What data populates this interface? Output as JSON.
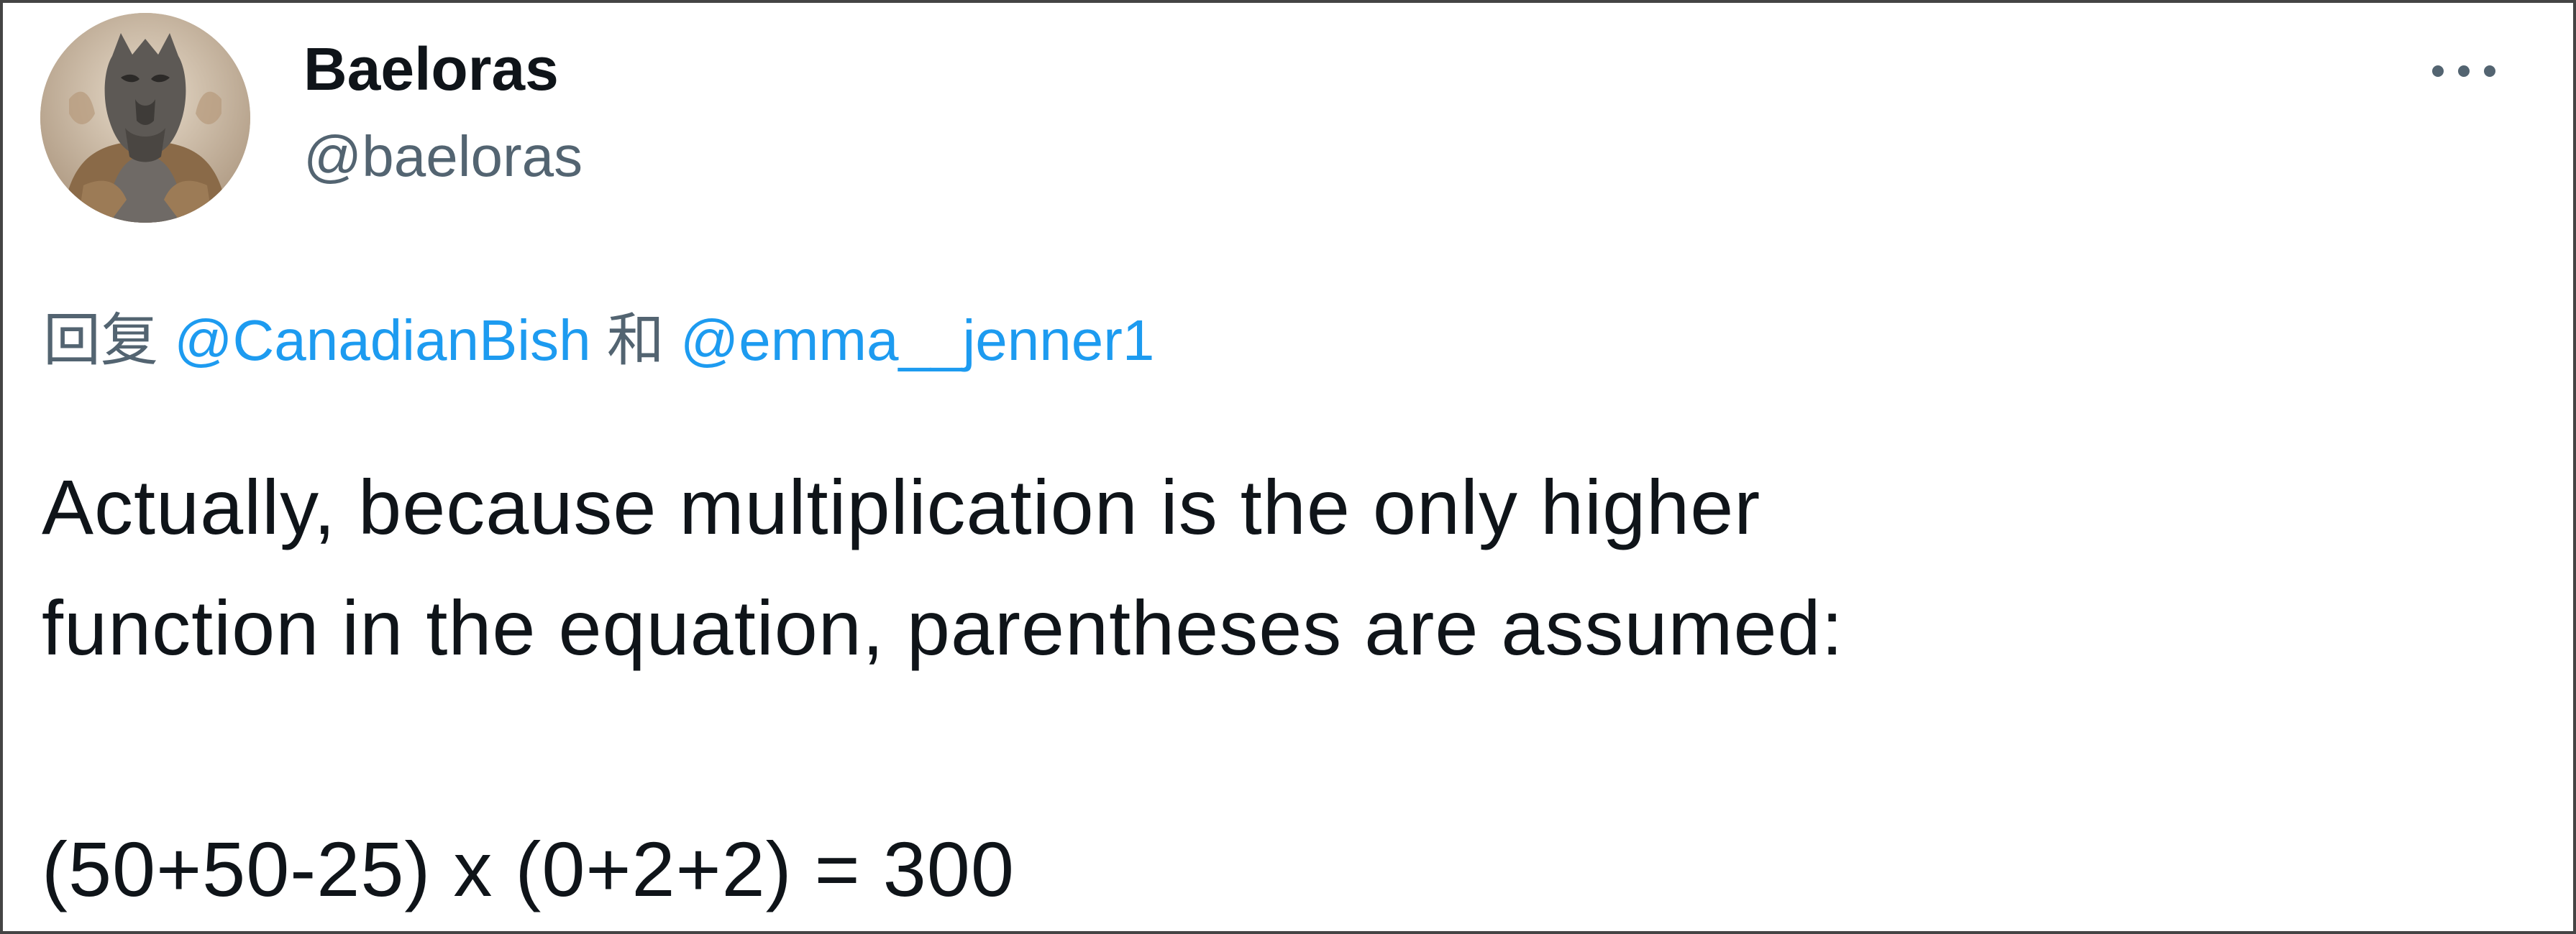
{
  "tweet": {
    "display_name": "Baeloras",
    "handle": "@baeloras",
    "avatar_icon": "avatar-image",
    "more_icon": "more-options-icon",
    "reply": {
      "prefix": "回复",
      "mentions": [
        "@CanadianBish",
        "@emma__jenner1"
      ],
      "conjunction": "和"
    },
    "text_lines": [
      "Actually, because multiplication is the only higher",
      "function in the equation, parentheses are assumed:",
      "",
      "(50+50-25) x (0+2+2) = 300"
    ]
  },
  "colors": {
    "text_primary": "#0f1419",
    "text_secondary": "#536471",
    "link": "#1d9bf0",
    "border": "#444444"
  }
}
